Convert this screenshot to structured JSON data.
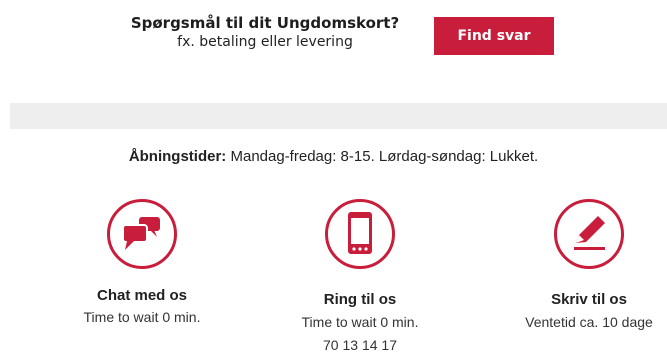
{
  "faq": {
    "title": "Spørgsmål til dit Ungdomskort?",
    "subtitle": "fx. betaling eller levering",
    "button_label": "Find svar"
  },
  "hours": {
    "label": "Åbningstider:",
    "text": "Mandag-fredag: 8-15. Lørdag-søndag: Lukket."
  },
  "contacts": {
    "chat": {
      "icon": "chat-bubbles-icon",
      "title": "Chat med os",
      "wait": "Time to wait 0 min."
    },
    "ring": {
      "icon": "phone-icon",
      "title": "Ring til os",
      "wait": "Time to wait 0 min.",
      "phone": "70 13 14 17"
    },
    "write": {
      "icon": "pencil-icon",
      "title": "Skriv til os",
      "wait": "Ventetid ca. 10 dage"
    }
  },
  "colors": {
    "accent": "#c81d3b",
    "band": "#eeeeee",
    "text": "#222222"
  }
}
